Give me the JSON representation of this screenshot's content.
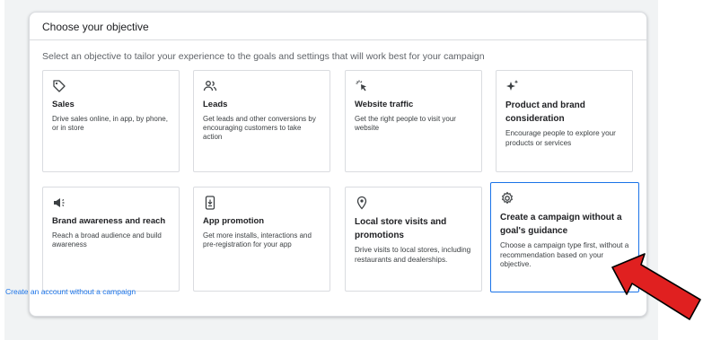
{
  "card": {
    "title": "Choose your objective",
    "subtitle": "Select an objective to tailor your experience to the goals and settings that will work best for your campaign"
  },
  "objectives": [
    {
      "icon": "tag-icon",
      "title": "Sales",
      "description": "Drive sales online, in app, by phone, or in store"
    },
    {
      "icon": "people-icon",
      "title": "Leads",
      "description": "Get leads and other conversions by encouraging customers to take action"
    },
    {
      "icon": "cursor-click-icon",
      "title": "Website traffic",
      "description": "Get the right people to visit your website"
    },
    {
      "icon": "sparkle-icon",
      "title": "Product and brand consideration",
      "description": "Encourage people to explore your products or services"
    },
    {
      "icon": "megaphone-icon",
      "title": "Brand awareness and reach",
      "description": "Reach a broad audience and build awareness"
    },
    {
      "icon": "phone-download-icon",
      "title": "App promotion",
      "description": "Get more installs, interactions and pre-registration for your app"
    },
    {
      "icon": "location-pin-icon",
      "title": "Local store visits and promotions",
      "description": "Drive visits to local stores, including restaurants and dealerships."
    },
    {
      "icon": "gear-icon",
      "title": "Create a campaign without a goal's guidance",
      "description": "Choose a campaign type first, without a recommendation based on your objective."
    }
  ],
  "footer": {
    "link_label": "Create an account without a campaign"
  },
  "colors": {
    "accent": "#1a73e8",
    "arrow": "#e02020"
  }
}
